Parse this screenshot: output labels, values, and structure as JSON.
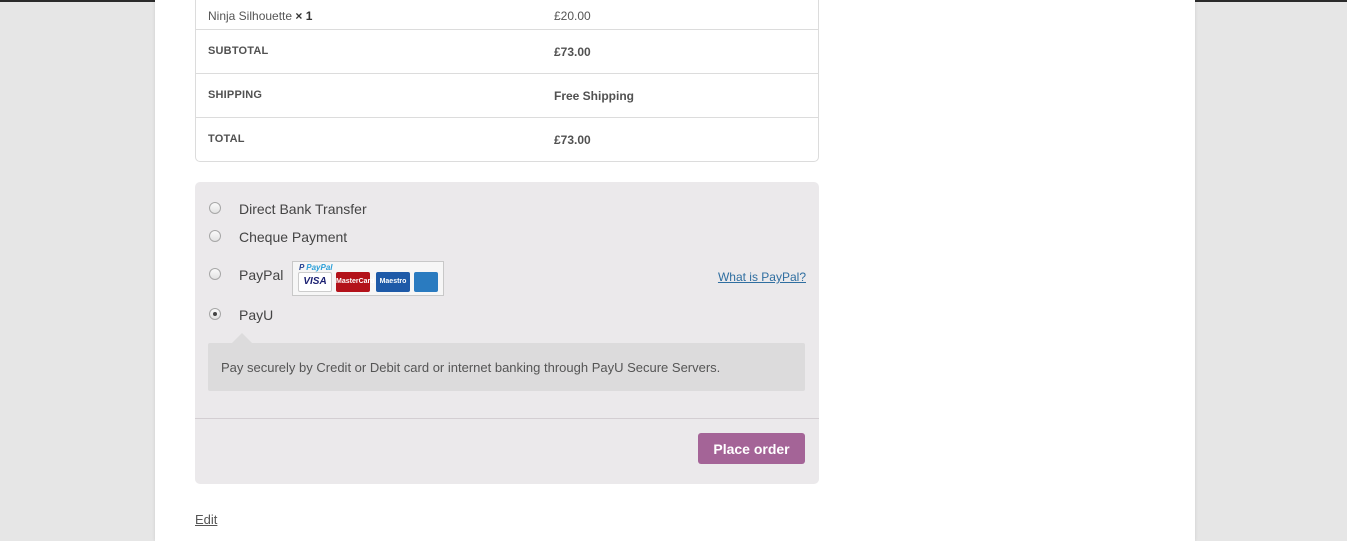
{
  "order_totals": {
    "item": {
      "name": "Ninja Silhouette",
      "qty": "× 1",
      "price": "£20.00"
    },
    "rows": [
      {
        "label": "SUBTOTAL",
        "value": "£73.00"
      },
      {
        "label": "SHIPPING",
        "value": "Free Shipping"
      },
      {
        "label": "TOTAL",
        "value": "£73.00"
      }
    ]
  },
  "payment": {
    "methods": [
      {
        "label": "Direct Bank Transfer",
        "selected": false
      },
      {
        "label": "Cheque Payment",
        "selected": false
      },
      {
        "label": "PayPal",
        "selected": false
      },
      {
        "label": "PayU",
        "selected": true
      }
    ],
    "paypal_logo": {
      "brand": "PayPal",
      "cards": [
        "VISA",
        "MasterCard",
        "Maestro",
        "AMERICAN EXPRESS"
      ]
    },
    "what_is_paypal": "What is PayPal?",
    "payu_description": "Pay securely by Credit or Debit card or internet banking through PayU Secure Servers.",
    "place_order_label": "Place order",
    "accent_color": "#a46497"
  },
  "edit_link": "Edit"
}
